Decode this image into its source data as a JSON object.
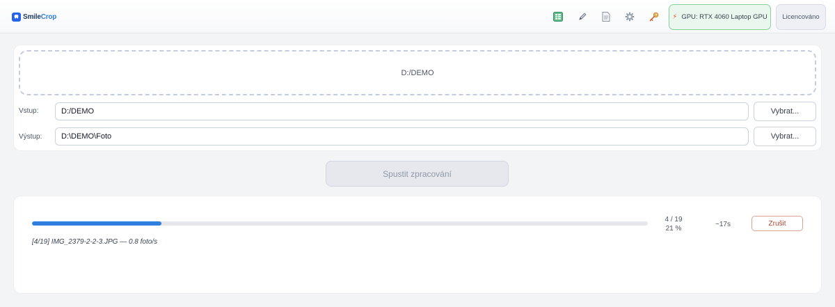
{
  "app": {
    "logo_part1": "Smile",
    "logo_part2": "Crop",
    "brand_color": "#2f7fd6"
  },
  "header": {
    "icons": [
      "spreadsheet-icon",
      "pencil-icon",
      "document-icon",
      "gear-icon",
      "key-icon"
    ],
    "gpu_label": "GPU: RTX 4060 Laptop GPU",
    "license_label": "Licencováno"
  },
  "input_card": {
    "dropzone_text": "D:/DEMO",
    "input_label": "Vstup:",
    "input_value": "D:/DEMO",
    "output_label": "Výstup:",
    "output_value": "D:\\DEMO\\Foto",
    "pick_input_label": "Vybrat...",
    "pick_output_label": "Vybrat..."
  },
  "run_button_label": "Spustit zpracování",
  "progress": {
    "fraction": 0.21,
    "count_text": "4 / 19",
    "percent_text": "21 %",
    "eta_text": "~17s",
    "cancel_label": "Zrušit",
    "status_text": "[4/19] IMG_2379-2-2-3.JPG  —  0.8 foto/s",
    "color": "#2f7fe0"
  }
}
